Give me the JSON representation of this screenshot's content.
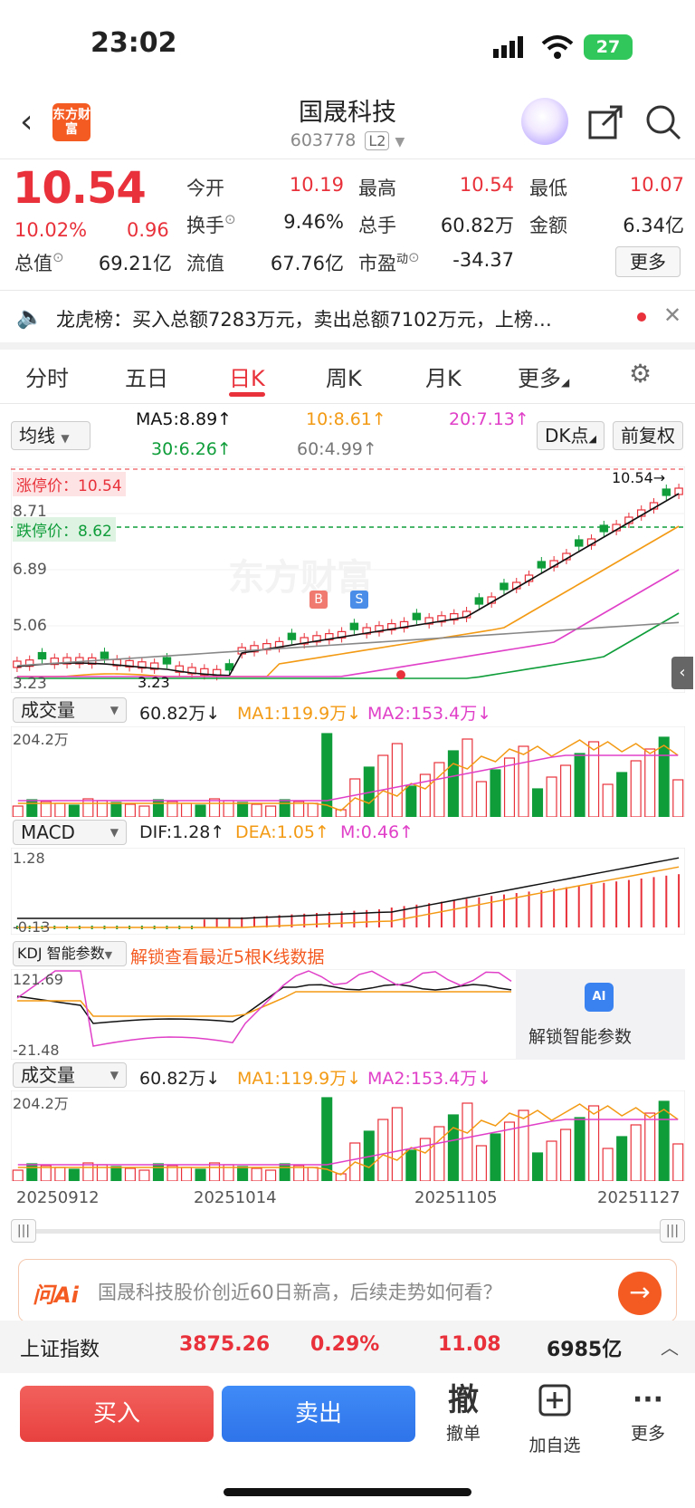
{
  "status_bar": {
    "time": "23:02",
    "battery": "27"
  },
  "header": {
    "logo": "东方财富",
    "name": "国晟科技",
    "code": "603778",
    "level": "L2"
  },
  "quote": {
    "price": "10.54",
    "change_pct": "10.02%",
    "change": "0.96",
    "open_label": "今开",
    "open": "10.19",
    "high_label": "最高",
    "high": "10.54",
    "low_label": "最低",
    "low": "10.07",
    "turnover_label": "换手",
    "turnover": "9.46%",
    "volume_label": "总手",
    "volume": "60.82万",
    "amount_label": "金额",
    "amount": "6.34亿",
    "mktcap_label": "总值",
    "mktcap": "69.21亿",
    "float_label": "流值",
    "float": "67.76亿",
    "pe_label": "市盈",
    "pe_sup": "动",
    "pe": "-34.37",
    "more": "更多"
  },
  "notice": {
    "text": "龙虎榜：买入总额7283万元，卖出总额7102万元，上榜…"
  },
  "tabs": [
    "分时",
    "五日",
    "日K",
    "周K",
    "月K",
    "更多"
  ],
  "ma_legend": {
    "selector": "均线",
    "ma5": "MA5:8.89↑",
    "ma10": "10:8.61↑",
    "ma20": "20:7.13↑",
    "ma30": "30:6.26↑",
    "ma60": "60:4.99↑",
    "dk": "DK点",
    "fq": "前复权"
  },
  "kline": {
    "limit_up_label": "涨停价：10.54",
    "limit_down_label": "跌停价：8.62",
    "y_labels": [
      "10.54",
      "8.71",
      "6.89",
      "5.06",
      "3.23"
    ],
    "last_price": "10.54→",
    "min_price": "3.23",
    "watermark": "东方财富",
    "b_marker": "B",
    "s_marker": "S"
  },
  "volume_panel": {
    "selector": "成交量",
    "val": "60.82万↓",
    "ma1": "MA1:119.9万↓",
    "ma2": "MA2:153.4万↓",
    "y_max": "204.2万"
  },
  "macd_panel": {
    "selector": "MACD",
    "dif": "DIF:1.28↑",
    "dea": "DEA:1.05↑",
    "m": "M:0.46↑",
    "y_max": "1.28",
    "y_min": "-0.13"
  },
  "kdj_panel": {
    "selector": "KDJ 智能参数",
    "unlock_text": "解锁查看最近5根K线数据",
    "y_max": "121.69",
    "y_min": "-21.48",
    "unlock_btn": "解锁智能参数",
    "ai_badge": "AI"
  },
  "volume_panel2": {
    "selector": "成交量",
    "val": "60.82万↓",
    "ma1": "MA1:119.9万↓",
    "ma2": "MA2:153.4万↓",
    "y_max": "204.2万"
  },
  "x_axis": [
    "20250912",
    "20251014",
    "20251105",
    "20251127"
  ],
  "ai_bar": {
    "logo": "问Ai",
    "text": "国晟科技股价创近60日新高，后续走势如何看？"
  },
  "index_bar": {
    "name": "上证指数",
    "value": "3875.26",
    "pct": "0.29%",
    "chg": "11.08",
    "amount": "6985亿"
  },
  "actions": {
    "buy": "买入",
    "sell": "卖出",
    "cancel": "撤单",
    "cancel_glyph": "撤",
    "watch": "加自选",
    "more": "更多"
  },
  "colors": {
    "up": "#e8313a",
    "down": "#0f9d3a",
    "ma5": "#111111",
    "ma10": "#f39a14",
    "ma20": "#e040c8",
    "ma30": "#0f9d3a",
    "ma60": "#888888",
    "brand": "#f45b22"
  }
}
